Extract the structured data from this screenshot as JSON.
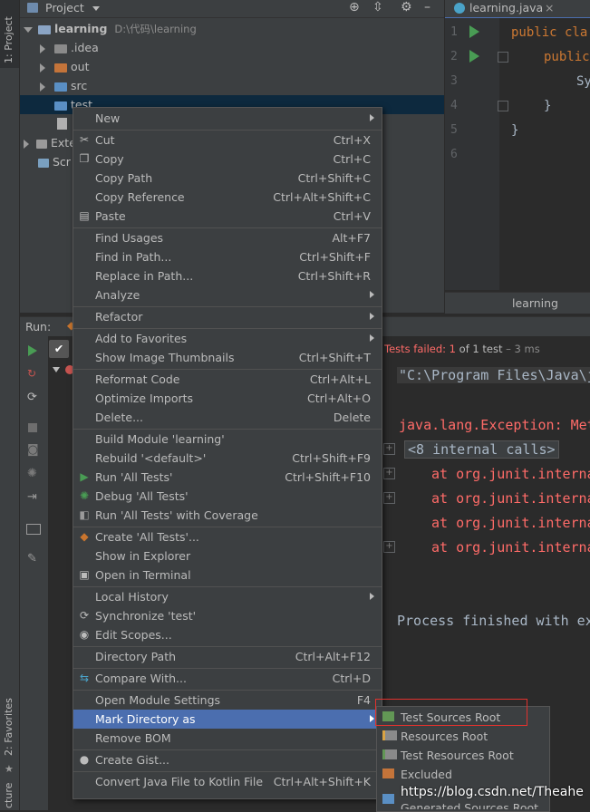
{
  "left_stripe": {
    "project_tab": "1: Project",
    "favorites_tab": "2: Favorites",
    "structure_tab": "cture"
  },
  "project_panel": {
    "title": "Project",
    "tree": [
      {
        "label": "learning",
        "path": "D:\\代码\\learning"
      },
      {
        "label": ".idea"
      },
      {
        "label": "out"
      },
      {
        "label": "src"
      },
      {
        "label": "test"
      },
      {
        "label": "Exte"
      },
      {
        "label": "Scr"
      }
    ]
  },
  "editor": {
    "tab_title": "learning.java",
    "line_numbers": [
      "1",
      "2",
      "3",
      "4",
      "5",
      "6"
    ],
    "lines": [
      "public cla",
      "public",
      "Sy",
      "}",
      "}"
    ],
    "footer_label": "learning"
  },
  "run_panel": {
    "title": "Run:",
    "status_failed": "Tests failed: 1",
    "status_rest": "of 1 test",
    "status_time": "– 3 ms",
    "console": [
      "\"C:\\Program Files\\Java\\j",
      "java.lang.Exception: Met",
      "<8 internal calls>",
      "at org.junit.interna",
      "at org.junit.interna",
      "at org.junit.interna",
      "at org.junit.interna",
      "Process finished with ex"
    ]
  },
  "context_menu": {
    "items": [
      {
        "label": "New",
        "shortcut": ""
      },
      {
        "label": "Cut",
        "shortcut": "Ctrl+X"
      },
      {
        "label": "Copy",
        "shortcut": "Ctrl+C"
      },
      {
        "label": "Copy Path",
        "shortcut": "Ctrl+Shift+C"
      },
      {
        "label": "Copy Reference",
        "shortcut": "Ctrl+Alt+Shift+C"
      },
      {
        "label": "Paste",
        "shortcut": "Ctrl+V"
      },
      {
        "label": "Find Usages",
        "shortcut": "Alt+F7"
      },
      {
        "label": "Find in Path...",
        "shortcut": "Ctrl+Shift+F"
      },
      {
        "label": "Replace in Path...",
        "shortcut": "Ctrl+Shift+R"
      },
      {
        "label": "Analyze",
        "shortcut": ""
      },
      {
        "label": "Refactor",
        "shortcut": ""
      },
      {
        "label": "Add to Favorites",
        "shortcut": ""
      },
      {
        "label": "Show Image Thumbnails",
        "shortcut": "Ctrl+Shift+T"
      },
      {
        "label": "Reformat Code",
        "shortcut": "Ctrl+Alt+L"
      },
      {
        "label": "Optimize Imports",
        "shortcut": "Ctrl+Alt+O"
      },
      {
        "label": "Delete...",
        "shortcut": "Delete"
      },
      {
        "label": "Build Module 'learning'",
        "shortcut": ""
      },
      {
        "label": "Rebuild '<default>'",
        "shortcut": "Ctrl+Shift+F9"
      },
      {
        "label": "Run 'All Tests'",
        "shortcut": "Ctrl+Shift+F10"
      },
      {
        "label": "Debug 'All Tests'",
        "shortcut": ""
      },
      {
        "label": "Run 'All Tests' with Coverage",
        "shortcut": ""
      },
      {
        "label": "Create 'All Tests'...",
        "shortcut": ""
      },
      {
        "label": "Show in Explorer",
        "shortcut": ""
      },
      {
        "label": "Open in Terminal",
        "shortcut": ""
      },
      {
        "label": "Local History",
        "shortcut": ""
      },
      {
        "label": "Synchronize 'test'",
        "shortcut": ""
      },
      {
        "label": "Edit Scopes...",
        "shortcut": ""
      },
      {
        "label": "Directory Path",
        "shortcut": "Ctrl+Alt+F12"
      },
      {
        "label": "Compare With...",
        "shortcut": "Ctrl+D"
      },
      {
        "label": "Open Module Settings",
        "shortcut": "F4"
      },
      {
        "label": "Mark Directory as",
        "shortcut": ""
      },
      {
        "label": "Remove BOM",
        "shortcut": ""
      },
      {
        "label": "Create Gist...",
        "shortcut": ""
      },
      {
        "label": "Convert Java File to Kotlin File",
        "shortcut": "Ctrl+Alt+Shift+K"
      }
    ]
  },
  "submenu": {
    "items": [
      {
        "label": "Test Sources Root"
      },
      {
        "label": "Resources Root"
      },
      {
        "label": "Test Resources Root"
      },
      {
        "label": "Excluded"
      },
      {
        "label": "Generated Sources Root"
      }
    ]
  },
  "watermark": "https://blog.csdn.net/Theahe",
  "colors": {
    "selection": "#4b6eaf",
    "test_folder": "#629755",
    "error_text": "#ff6b68",
    "highlight_box": "#e0322e"
  }
}
